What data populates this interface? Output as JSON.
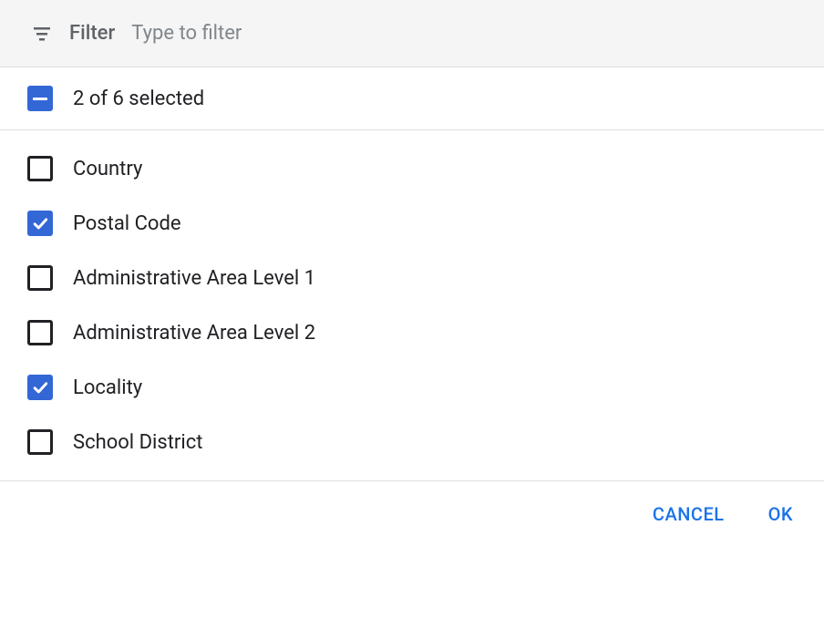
{
  "filter": {
    "label": "Filter",
    "placeholder": "Type to filter"
  },
  "summary": {
    "text": "2 of 6 selected"
  },
  "options": [
    {
      "label": "Country",
      "checked": false
    },
    {
      "label": "Postal Code",
      "checked": true
    },
    {
      "label": "Administrative Area Level 1",
      "checked": false
    },
    {
      "label": "Administrative Area Level 2",
      "checked": false
    },
    {
      "label": "Locality",
      "checked": true
    },
    {
      "label": "School District",
      "checked": false
    }
  ],
  "actions": {
    "cancel": "CANCEL",
    "ok": "OK"
  }
}
